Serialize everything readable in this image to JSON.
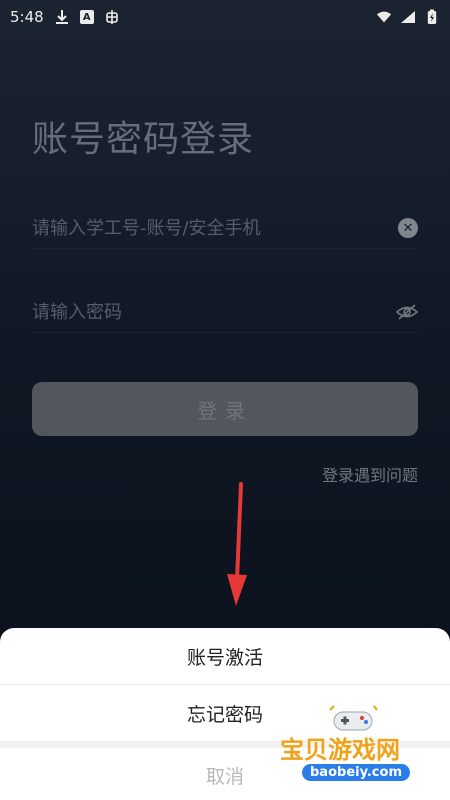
{
  "status": {
    "time": "5:48",
    "app_badge_text": "A"
  },
  "page": {
    "title": "账号密码登录",
    "account_placeholder": "请输入学工号-账号/安全手机",
    "password_placeholder": "请输入密码",
    "login_button": "登录",
    "help_link": "登录遇到问题"
  },
  "sheet": {
    "items": [
      "账号激活",
      "忘记密码"
    ],
    "cancel": "取消"
  },
  "watermark": {
    "title": "宝贝游戏网",
    "subtitle": "baobeiy.com"
  },
  "colors": {
    "background_top": "#1f2736",
    "background_bottom": "#0b111c",
    "arrow": "#e53935",
    "sheet_background": "#ffffff",
    "watermark_orange": "#f0a21a",
    "watermark_blue": "#2b7de9"
  }
}
